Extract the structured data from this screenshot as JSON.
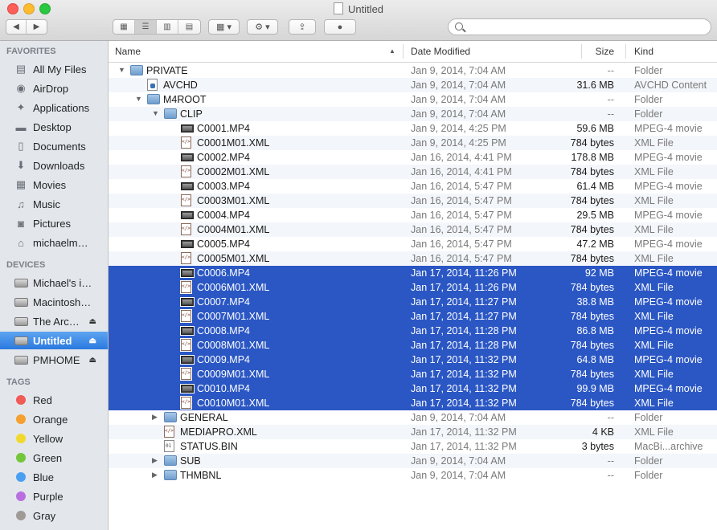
{
  "window": {
    "title": "Untitled"
  },
  "toolbar": {
    "back": "◀",
    "forward": "▶",
    "views": [
      "icon",
      "list",
      "column",
      "coverflow"
    ],
    "active_view": 1,
    "arrange_icon": "▦ ▾",
    "action_icon": "⚙ ▾",
    "share_icon": "⇪",
    "tag_icon": "●",
    "search_placeholder": ""
  },
  "sidebar": {
    "favorites_header": "FAVORITES",
    "favorites": [
      {
        "label": "All My Files",
        "icon": "all-files-icon",
        "glyph": "▤"
      },
      {
        "label": "AirDrop",
        "icon": "airdrop-icon",
        "glyph": "◉"
      },
      {
        "label": "Applications",
        "icon": "applications-icon",
        "glyph": "✦"
      },
      {
        "label": "Desktop",
        "icon": "desktop-icon",
        "glyph": "▬"
      },
      {
        "label": "Documents",
        "icon": "documents-icon",
        "glyph": "▯"
      },
      {
        "label": "Downloads",
        "icon": "downloads-icon",
        "glyph": "⬇"
      },
      {
        "label": "Movies",
        "icon": "movies-icon",
        "glyph": "▦"
      },
      {
        "label": "Music",
        "icon": "music-icon",
        "glyph": "♫"
      },
      {
        "label": "Pictures",
        "icon": "pictures-icon",
        "glyph": "◙"
      },
      {
        "label": "michaelm…",
        "icon": "home-icon",
        "glyph": "⌂"
      }
    ],
    "devices_header": "DEVICES",
    "devices": [
      {
        "label": "Michael's i…",
        "icon": "imac-icon",
        "eject": false
      },
      {
        "label": "Macintosh…",
        "icon": "hard-drive-icon",
        "eject": false
      },
      {
        "label": "The Arc…",
        "icon": "external-drive-icon",
        "eject": true
      },
      {
        "label": "Untitled",
        "icon": "sd-card-icon",
        "eject": true,
        "selected": true
      },
      {
        "label": "PMHOME",
        "icon": "usb-drive-icon",
        "eject": true
      }
    ],
    "eject_glyph": "⏏",
    "tags_header": "TAGS",
    "tags": [
      {
        "label": "Red",
        "color": "#f05a57"
      },
      {
        "label": "Orange",
        "color": "#f5a02f"
      },
      {
        "label": "Yellow",
        "color": "#f0d92c"
      },
      {
        "label": "Green",
        "color": "#73c63a"
      },
      {
        "label": "Blue",
        "color": "#4a9ff2"
      },
      {
        "label": "Purple",
        "color": "#b96fe0"
      },
      {
        "label": "Gray",
        "color": "#a09a96"
      }
    ]
  },
  "columns": {
    "name": "Name",
    "date": "Date Modified",
    "size": "Size",
    "kind": "Kind"
  },
  "rows": [
    {
      "name": "PRIVATE",
      "date": "Jan 9, 2014, 7:04 AM",
      "size": "--",
      "kind": "Folder",
      "type": "folder",
      "depth": 0,
      "disclosure": "open"
    },
    {
      "name": "AVCHD",
      "date": "Jan 9, 2014, 7:04 AM",
      "size": "31.6 MB",
      "kind": "AVCHD Content",
      "type": "avchd",
      "depth": 1
    },
    {
      "name": "M4ROOT",
      "date": "Jan 9, 2014, 7:04 AM",
      "size": "--",
      "kind": "Folder",
      "type": "folder",
      "depth": 1,
      "disclosure": "open"
    },
    {
      "name": "CLIP",
      "date": "Jan 9, 2014, 7:04 AM",
      "size": "--",
      "kind": "Folder",
      "type": "folder",
      "depth": 2,
      "disclosure": "open"
    },
    {
      "name": "C0001.MP4",
      "date": "Jan 9, 2014, 4:25 PM",
      "size": "59.6 MB",
      "kind": "MPEG-4 movie",
      "type": "movie",
      "depth": 3
    },
    {
      "name": "C0001M01.XML",
      "date": "Jan 9, 2014, 4:25 PM",
      "size": "784 bytes",
      "kind": "XML File",
      "type": "xml",
      "depth": 3
    },
    {
      "name": "C0002.MP4",
      "date": "Jan 16, 2014, 4:41 PM",
      "size": "178.8 MB",
      "kind": "MPEG-4 movie",
      "type": "movie",
      "depth": 3
    },
    {
      "name": "C0002M01.XML",
      "date": "Jan 16, 2014, 4:41 PM",
      "size": "784 bytes",
      "kind": "XML File",
      "type": "xml",
      "depth": 3
    },
    {
      "name": "C0003.MP4",
      "date": "Jan 16, 2014, 5:47 PM",
      "size": "61.4 MB",
      "kind": "MPEG-4 movie",
      "type": "movie",
      "depth": 3
    },
    {
      "name": "C0003M01.XML",
      "date": "Jan 16, 2014, 5:47 PM",
      "size": "784 bytes",
      "kind": "XML File",
      "type": "xml",
      "depth": 3
    },
    {
      "name": "C0004.MP4",
      "date": "Jan 16, 2014, 5:47 PM",
      "size": "29.5 MB",
      "kind": "MPEG-4 movie",
      "type": "movie",
      "depth": 3
    },
    {
      "name": "C0004M01.XML",
      "date": "Jan 16, 2014, 5:47 PM",
      "size": "784 bytes",
      "kind": "XML File",
      "type": "xml",
      "depth": 3
    },
    {
      "name": "C0005.MP4",
      "date": "Jan 16, 2014, 5:47 PM",
      "size": "47.2 MB",
      "kind": "MPEG-4 movie",
      "type": "movie",
      "depth": 3
    },
    {
      "name": "C0005M01.XML",
      "date": "Jan 16, 2014, 5:47 PM",
      "size": "784 bytes",
      "kind": "XML File",
      "type": "xml",
      "depth": 3
    },
    {
      "name": "C0006.MP4",
      "date": "Jan 17, 2014, 11:26 PM",
      "size": "92 MB",
      "kind": "MPEG-4 movie",
      "type": "movie",
      "depth": 3,
      "selected": true
    },
    {
      "name": "C0006M01.XML",
      "date": "Jan 17, 2014, 11:26 PM",
      "size": "784 bytes",
      "kind": "XML File",
      "type": "xml",
      "depth": 3,
      "selected": true
    },
    {
      "name": "C0007.MP4",
      "date": "Jan 17, 2014, 11:27 PM",
      "size": "38.8 MB",
      "kind": "MPEG-4 movie",
      "type": "movie",
      "depth": 3,
      "selected": true
    },
    {
      "name": "C0007M01.XML",
      "date": "Jan 17, 2014, 11:27 PM",
      "size": "784 bytes",
      "kind": "XML File",
      "type": "xml",
      "depth": 3,
      "selected": true
    },
    {
      "name": "C0008.MP4",
      "date": "Jan 17, 2014, 11:28 PM",
      "size": "86.8 MB",
      "kind": "MPEG-4 movie",
      "type": "movie",
      "depth": 3,
      "selected": true
    },
    {
      "name": "C0008M01.XML",
      "date": "Jan 17, 2014, 11:28 PM",
      "size": "784 bytes",
      "kind": "XML File",
      "type": "xml",
      "depth": 3,
      "selected": true
    },
    {
      "name": "C0009.MP4",
      "date": "Jan 17, 2014, 11:32 PM",
      "size": "64.8 MB",
      "kind": "MPEG-4 movie",
      "type": "movie",
      "depth": 3,
      "selected": true
    },
    {
      "name": "C0009M01.XML",
      "date": "Jan 17, 2014, 11:32 PM",
      "size": "784 bytes",
      "kind": "XML File",
      "type": "xml",
      "depth": 3,
      "selected": true
    },
    {
      "name": "C0010.MP4",
      "date": "Jan 17, 2014, 11:32 PM",
      "size": "99.9 MB",
      "kind": "MPEG-4 movie",
      "type": "movie",
      "depth": 3,
      "selected": true
    },
    {
      "name": "C0010M01.XML",
      "date": "Jan 17, 2014, 11:32 PM",
      "size": "784 bytes",
      "kind": "XML File",
      "type": "xml",
      "depth": 3,
      "selected": true
    },
    {
      "name": "GENERAL",
      "date": "Jan 9, 2014, 7:04 AM",
      "size": "--",
      "kind": "Folder",
      "type": "folder",
      "depth": 2,
      "disclosure": "closed"
    },
    {
      "name": "MEDIAPRO.XML",
      "date": "Jan 17, 2014, 11:32 PM",
      "size": "4 KB",
      "kind": "XML File",
      "type": "xml",
      "depth": 2
    },
    {
      "name": "STATUS.BIN",
      "date": "Jan 17, 2014, 11:32 PM",
      "size": "3 bytes",
      "kind": "MacBi...archive",
      "type": "bin",
      "depth": 2
    },
    {
      "name": "SUB",
      "date": "Jan 9, 2014, 7:04 AM",
      "size": "--",
      "kind": "Folder",
      "type": "folder",
      "depth": 2,
      "disclosure": "closed"
    },
    {
      "name": "THMBNL",
      "date": "Jan 9, 2014, 7:04 AM",
      "size": "--",
      "kind": "Folder",
      "type": "folder",
      "depth": 2,
      "disclosure": "closed"
    }
  ],
  "glyphs": {
    "open": "▼",
    "closed": "▶",
    "sort": "▲"
  },
  "colors": {
    "selection": "#2b57c4",
    "sidebar_selection": "#2a79e0"
  }
}
